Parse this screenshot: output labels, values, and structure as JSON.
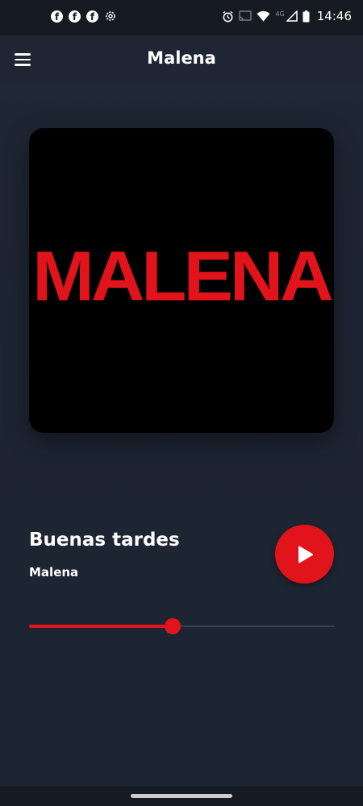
{
  "status_bar": {
    "time": "14:46",
    "network": "4G",
    "left_icons": [
      "facebook-icon",
      "facebook-icon",
      "facebook-icon",
      "settings-icon"
    ],
    "right_icons": [
      "alarm-icon",
      "cast-icon",
      "wifi-icon",
      "signal-icon",
      "battery-icon"
    ]
  },
  "app_bar": {
    "title": "Malena",
    "menu_icon": "menu-icon"
  },
  "artwork": {
    "logo_text": "MALENA",
    "logo_color": "#e2141b",
    "background": "#000000"
  },
  "track": {
    "title": "Buenas tardes",
    "artist": "Malena"
  },
  "player": {
    "play_icon": "play-icon",
    "progress_fraction": 0.47,
    "accent_color": "#e2141b"
  }
}
